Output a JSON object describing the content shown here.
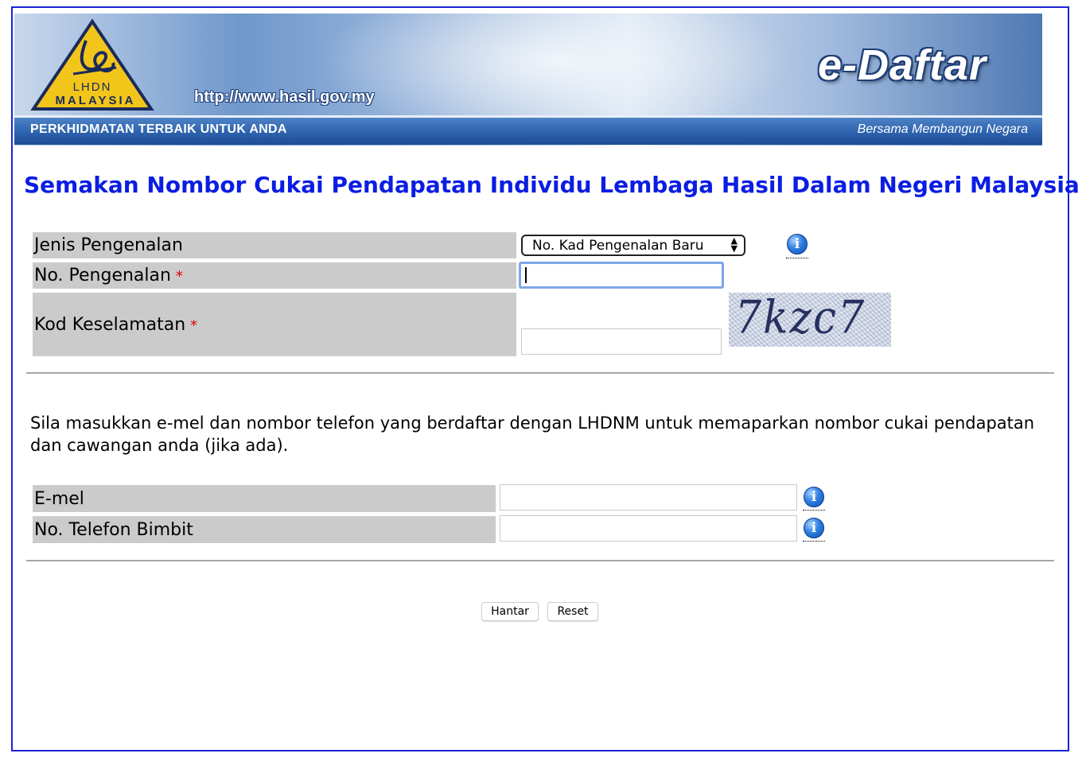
{
  "banner": {
    "logo_top": "LHDN",
    "logo_bottom": "MALAYSIA",
    "url": "http://www.hasil.gov.my",
    "app_name": "e-Daftar",
    "slogan": "PERKHIDMATAN TERBAIK UNTUK ANDA",
    "motto": "Bersama Membangun Negara"
  },
  "title": "Semakan Nombor Cukai Pendapatan Individu Lembaga Hasil Dalam Negeri Malaysia",
  "form": {
    "id_type_label": "Jenis Pengenalan",
    "id_type_value": "No. Kad Pengenalan Baru",
    "id_no_label": "No. Pengenalan",
    "security_label": "Kod Keselamatan",
    "required_mark": "*",
    "captcha_text": "7kzc7",
    "id_no_value": "",
    "security_value": ""
  },
  "instructions": "Sila masukkan e-mel dan nombor telefon yang berdaftar dengan LHDNM untuk memaparkan nombor cukai pendapatan dan cawangan anda (jika ada).",
  "contact": {
    "email_label": "E-mel",
    "phone_label": "No. Telefon Bimbit",
    "email_value": "",
    "phone_value": ""
  },
  "buttons": {
    "submit": "Hantar",
    "reset": "Reset"
  },
  "colors": {
    "title": "#0b1de3",
    "label_bg": "#cbcbcb",
    "frame": "#1a24d6",
    "required": "#e00000"
  },
  "icons": [
    "info-icon",
    "dropdown-arrows-icon",
    "lhdn-logo"
  ]
}
